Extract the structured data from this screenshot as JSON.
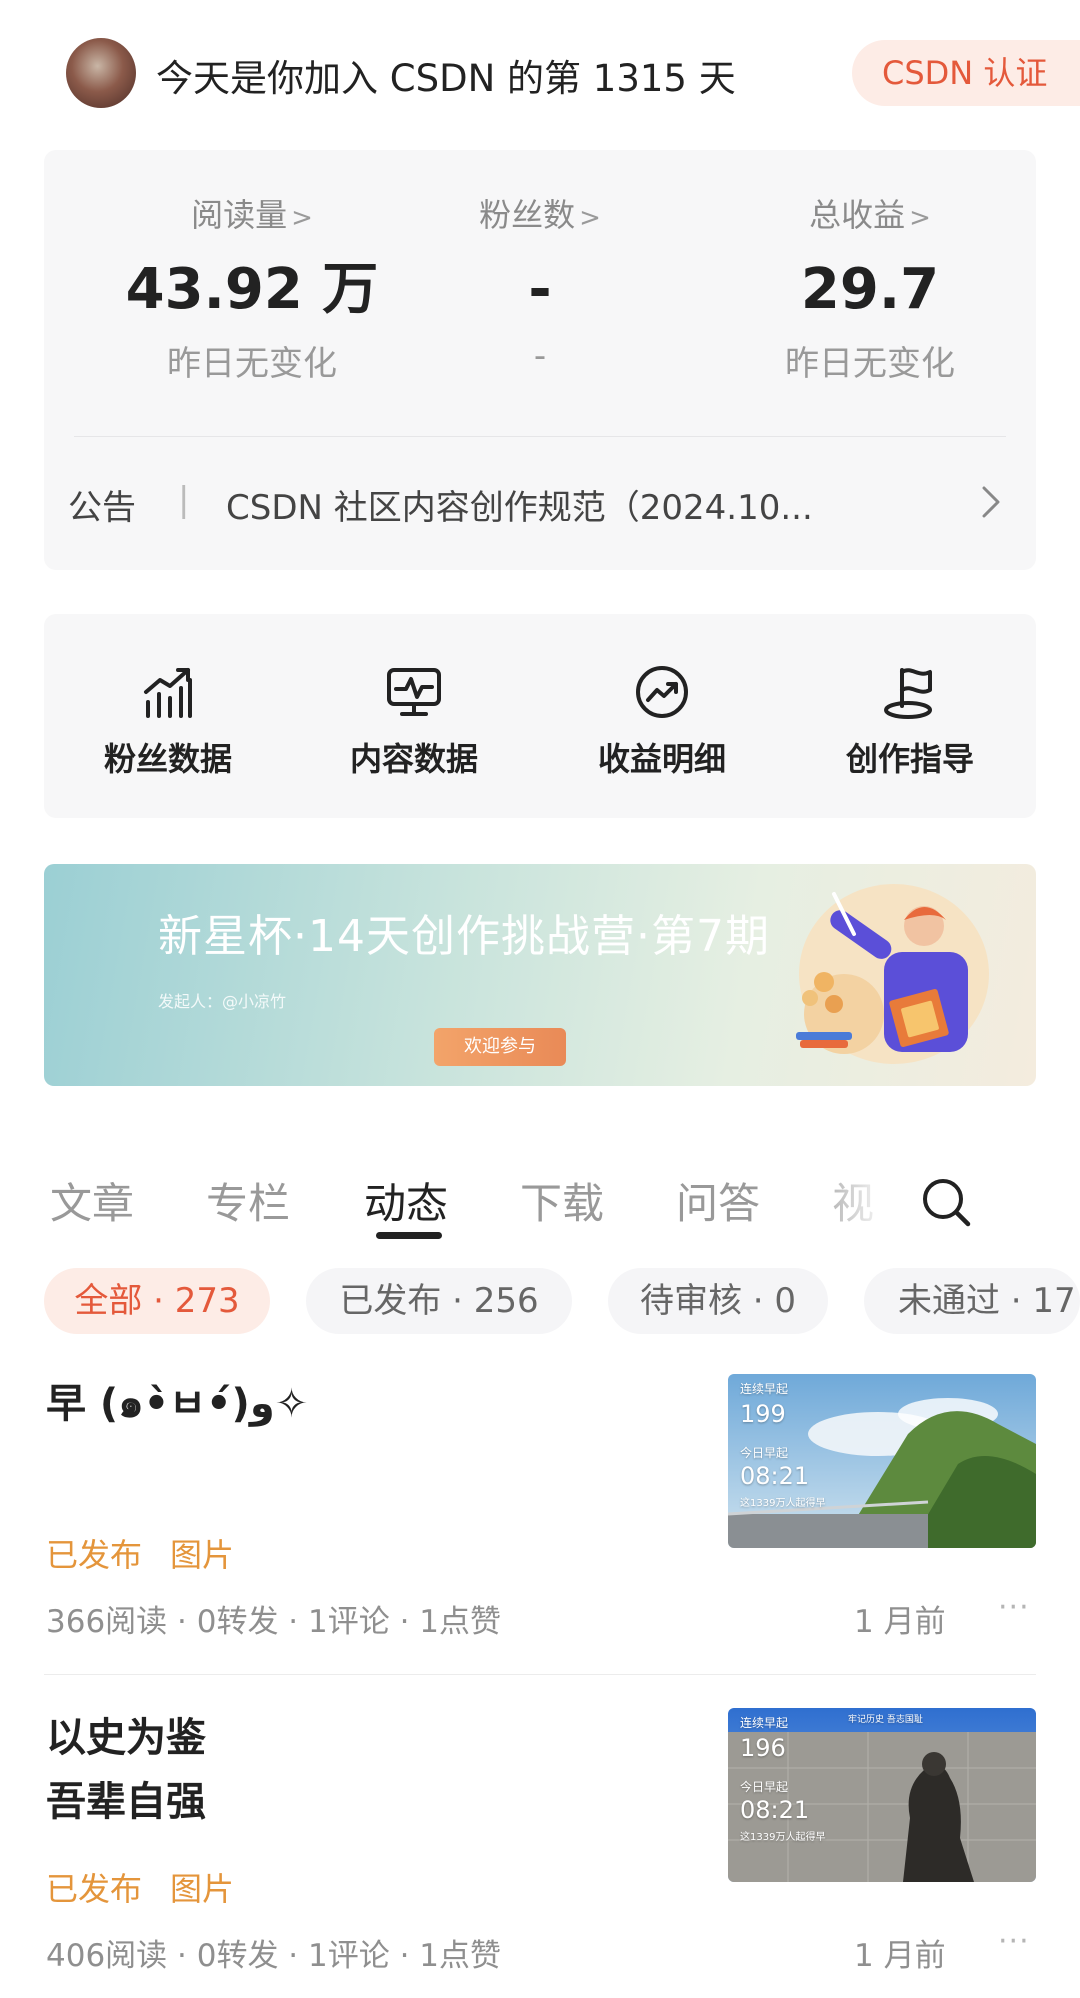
{
  "header": {
    "title": "今天是你加入 CSDN 的第 1315 天",
    "cert_label": "CSDN 认证"
  },
  "stats": [
    {
      "label": "阅读量",
      "value": "43.92 万",
      "sub": "昨日无变化"
    },
    {
      "label": "粉丝数",
      "value": "-",
      "sub": "-"
    },
    {
      "label": "总收益",
      "value": "29.7",
      "sub": "昨日无变化"
    }
  ],
  "stat_chevron": ">",
  "notice": {
    "label": "公告",
    "separator": "|",
    "text": "CSDN 社区内容创作规范（2024.10..."
  },
  "tools": [
    {
      "label": "粉丝数据",
      "icon": "bar-chart-icon"
    },
    {
      "label": "内容数据",
      "icon": "monitor-icon"
    },
    {
      "label": "收益明细",
      "icon": "income-icon"
    },
    {
      "label": "创作指导",
      "icon": "flag-icon"
    }
  ],
  "banner": {
    "title": "新星杯·14天创作挑战营·第7期",
    "subtitle": "发起人：@小凉竹",
    "button_label": "欢迎参与"
  },
  "tabs": [
    "文章",
    "专栏",
    "动态",
    "下载",
    "问答",
    "视"
  ],
  "active_tab": "动态",
  "filters": [
    {
      "label": "全部 · 273",
      "active": true
    },
    {
      "label": "已发布 · 256",
      "active": false
    },
    {
      "label": "待审核 · 0",
      "active": false
    },
    {
      "label": "未通过 · 17",
      "active": false
    }
  ],
  "posts": [
    {
      "title_lines": [
        "早 (๑•̀ㅂ•́)و✧"
      ],
      "status": "已发布",
      "type": "图片",
      "stats": "366阅读 · 0转发 · 1评论 · 1点赞",
      "time": "1 月前",
      "more": "···",
      "thumb": {
        "line1": "连续早起",
        "count": "199",
        "line2": "今日早起",
        "time": "08:21",
        "line3": "这1339万人起得早"
      }
    },
    {
      "title_lines": [
        "以史为鉴",
        "吾辈自强"
      ],
      "status": "已发布",
      "type": "图片",
      "stats": "406阅读 · 0转发 · 1评论 · 1点赞",
      "time": "1 月前",
      "more": "···",
      "thumb": {
        "line1": "连续早起",
        "count": "196",
        "line2": "今日早起",
        "time": "08:21",
        "line3": "这1339万人起得早",
        "caption": "牢记历史 吾志国耻"
      }
    }
  ],
  "colors": {
    "accent": "#e4593b",
    "accent_bg": "#fdece6",
    "status": "#e4953b",
    "card_bg": "#f7f7f8"
  }
}
